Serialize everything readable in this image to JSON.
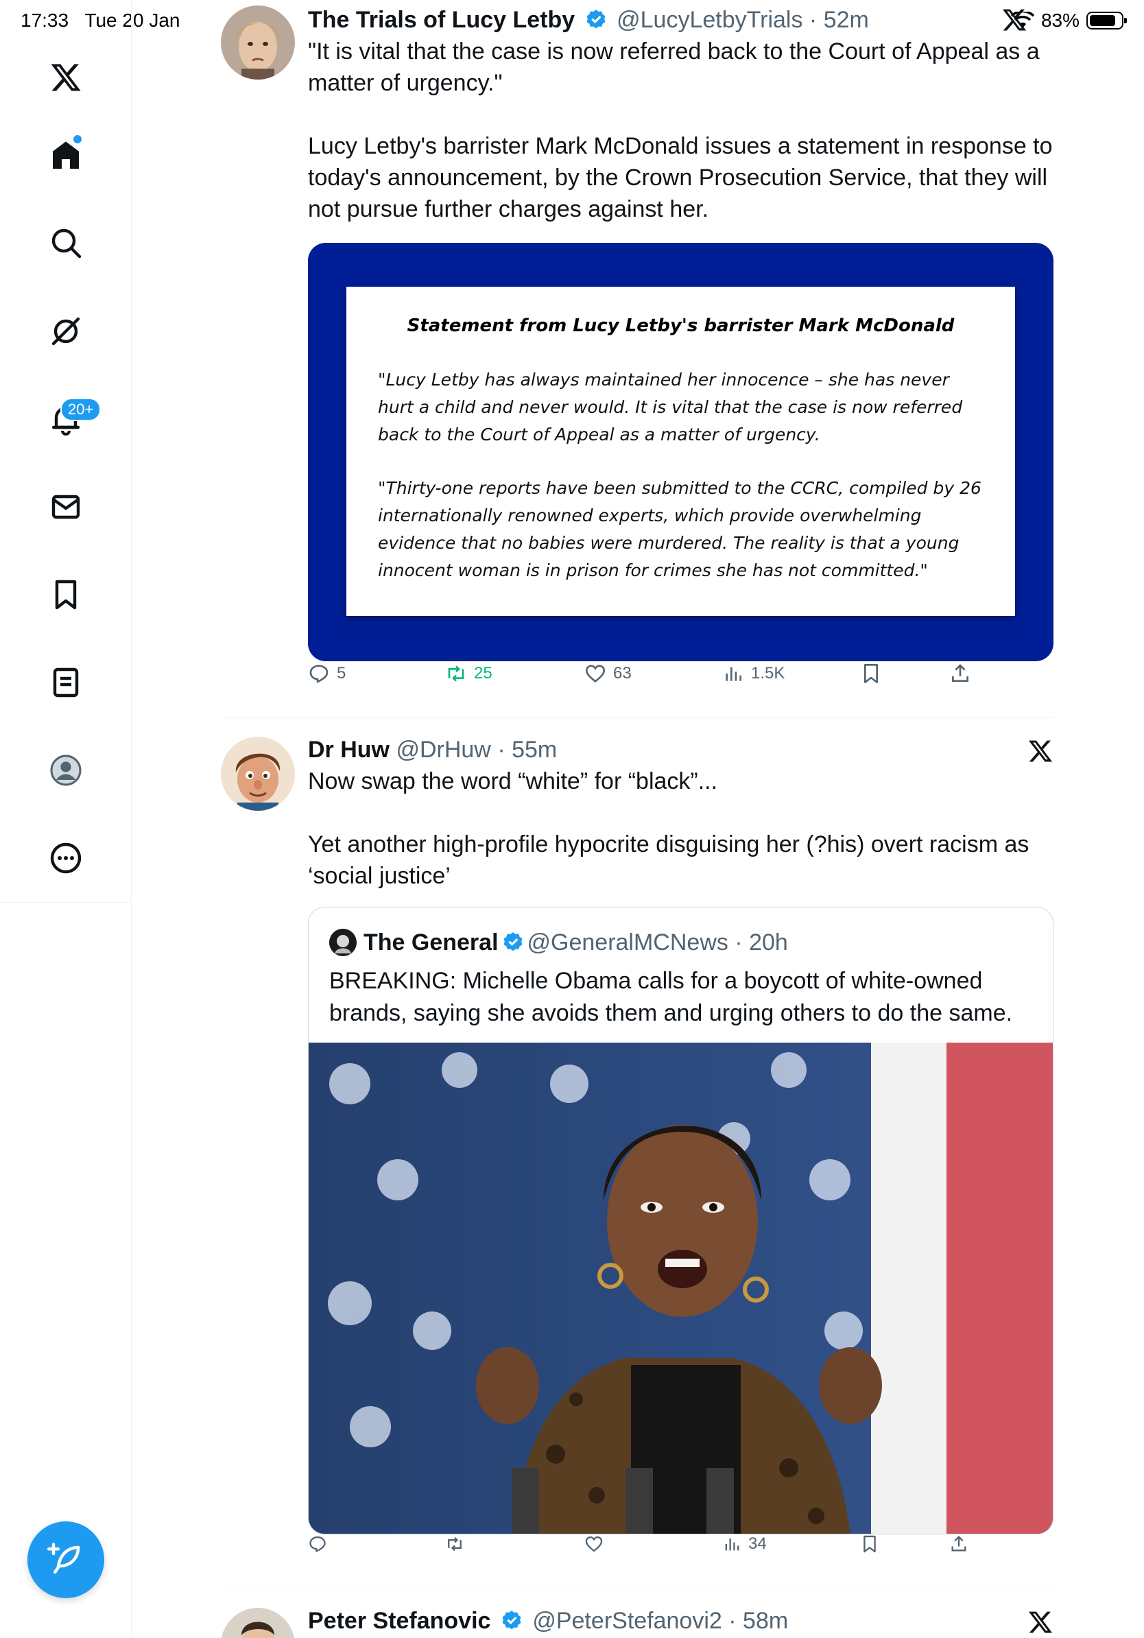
{
  "status_bar": {
    "time": "17:33",
    "date": "Tue 20 Jan",
    "battery": "83%",
    "battery_level": 0.83
  },
  "sidebar": {
    "items": [
      {
        "name": "x-logo",
        "icon": "x-logo-icon"
      },
      {
        "name": "home",
        "icon": "home-icon"
      },
      {
        "name": "explore",
        "icon": "search-icon"
      },
      {
        "name": "grok",
        "icon": "grok-icon"
      },
      {
        "name": "notifications",
        "icon": "bell-icon",
        "badge": "20+"
      },
      {
        "name": "messages",
        "icon": "mail-icon"
      },
      {
        "name": "bookmarks",
        "icon": "bookmark-icon"
      },
      {
        "name": "lists",
        "icon": "list-icon"
      },
      {
        "name": "profile",
        "icon": "avatar-icon"
      },
      {
        "name": "more",
        "icon": "more-icon"
      }
    ],
    "compose_icon": "compose-icon"
  },
  "tweets": [
    {
      "name": "The Trials of Lucy Letby",
      "handle": "@LucyLetbyTrials",
      "time": "52m",
      "verified": true,
      "text": "\"It is vital that the case is now referred back to the Court of Appeal as a matter of urgency.\"\n\nLucy Letby's barrister Mark McDonald issues a statement in response to today's announcement, by the Crown Prosecution Service, that they will not pursue further charges against her.",
      "statement": {
        "title": "Statement from Lucy Letby's barrister Mark McDonald",
        "paragraphs": [
          "\"Lucy Letby has always maintained her innocence – she has never hurt a child and never would. It is vital that the case is now referred back to the Court of Appeal as a matter of urgency.",
          "\"Thirty-one reports have been submitted to the CCRC, compiled by 26 internationally renowned experts, which provide overwhelming evidence that no babies were murdered. The reality is that a young innocent woman is in prison for crimes she has not committed.\""
        ]
      },
      "actions": {
        "replies": "5",
        "reposts": "25",
        "likes": "63",
        "views": "1.5K"
      }
    },
    {
      "name": "Dr Huw",
      "handle": "@DrHuw",
      "time": "55m",
      "verified": false,
      "text": "Now swap the word “white” for “black”...\n\nYet another high-profile hypocrite disguising her (?his) overt racism as ‘social justice’",
      "quote": {
        "name": "The General",
        "handle": "@GeneralMCNews",
        "time": "20h",
        "verified": true,
        "text": "BREAKING: Michelle Obama calls for a boycott of white-owned brands, saying she avoids them and urging others to do the same."
      },
      "actions": {
        "replies": "",
        "reposts": "",
        "likes": "",
        "views": "34"
      }
    },
    {
      "name": "Peter Stefanovic",
      "handle": "@PeterStefanovi2",
      "time": "58m",
      "verified": true
    }
  ],
  "colors": {
    "accent": "#1d9bf0",
    "repost": "#00ba7c",
    "statement_bg": "#001e96",
    "muted": "#536471"
  }
}
